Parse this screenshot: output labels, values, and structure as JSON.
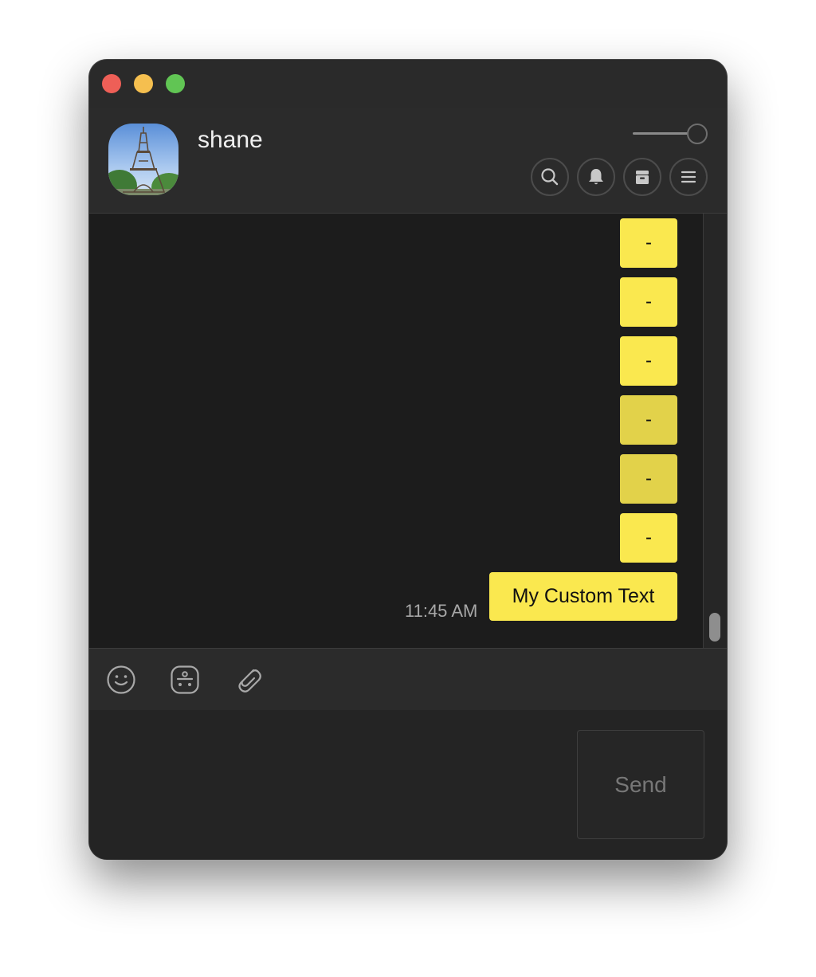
{
  "header": {
    "contact_name": "shane"
  },
  "zoom_slider": {
    "value": 1.0
  },
  "header_buttons": [
    {
      "icon": "search-icon"
    },
    {
      "icon": "bell-icon"
    },
    {
      "icon": "archive-icon"
    },
    {
      "icon": "menu-icon"
    }
  ],
  "messages": [
    {
      "text": "-"
    },
    {
      "text": "-"
    },
    {
      "text": "-"
    },
    {
      "text": "-"
    },
    {
      "text": "-"
    },
    {
      "text": "-"
    },
    {
      "text": "My Custom Text",
      "time": "11:45 AM"
    }
  ],
  "toolbar": {
    "tools": [
      "emoji-icon",
      "sticker-icon",
      "attachment-icon"
    ]
  },
  "composer": {
    "send_label": "Send"
  },
  "colors": {
    "bubble": "#fae84f",
    "bubble_dim": "#e2d24a",
    "chat_background": "#1c1c1c",
    "close": "#ee5f57",
    "minimize": "#f5bf4f",
    "maximize": "#61c554"
  }
}
